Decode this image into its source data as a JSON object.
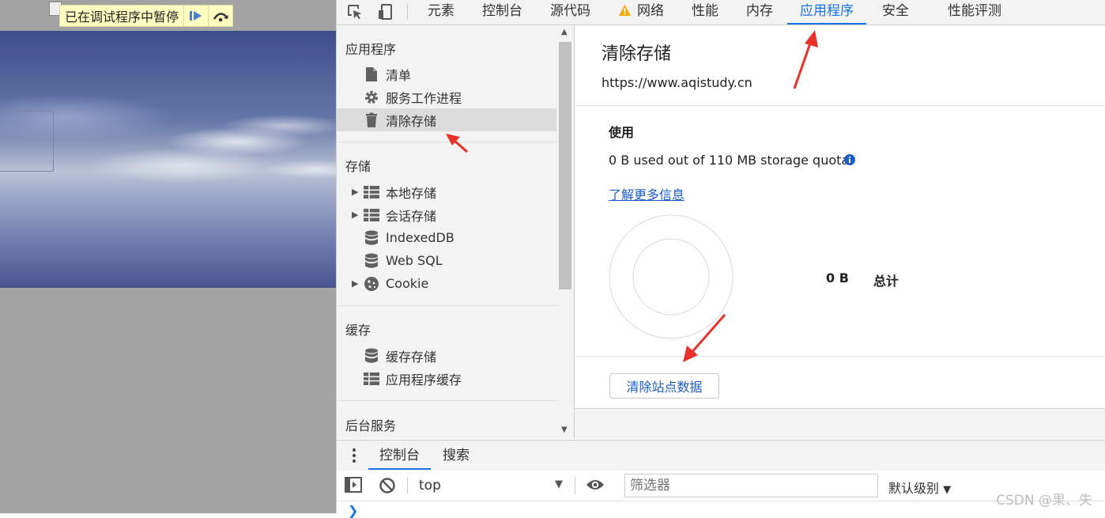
{
  "debug_banner": {
    "text": "已在调试程序中暂停",
    "resume_icon": "resume-icon",
    "step_over_icon": "step-over-icon"
  },
  "devtools": {
    "tabs": [
      "元素",
      "控制台",
      "源代码",
      "网络",
      "性能",
      "内存",
      "应用程序",
      "安全",
      "性能评测"
    ],
    "active_tab": "应用程序",
    "network_warning_icon": "warning-icon"
  },
  "sidebar": {
    "section_app": {
      "title": "应用程序",
      "items": [
        {
          "label": "清单",
          "icon": "file-icon"
        },
        {
          "label": "服务工作进程",
          "icon": "gear-icon"
        },
        {
          "label": "清除存储",
          "icon": "trash-icon",
          "selected": true
        }
      ]
    },
    "section_storage": {
      "title": "存储",
      "items": [
        {
          "label": "本地存储",
          "icon": "grid-icon",
          "expandable": true
        },
        {
          "label": "会话存储",
          "icon": "grid-icon",
          "expandable": true
        },
        {
          "label": "IndexedDB",
          "icon": "database-icon"
        },
        {
          "label": "Web SQL",
          "icon": "database-icon"
        },
        {
          "label": "Cookie",
          "icon": "cookie-icon",
          "expandable": true
        }
      ]
    },
    "section_cache": {
      "title": "缓存",
      "items": [
        {
          "label": "缓存存储",
          "icon": "database-icon"
        },
        {
          "label": "应用程序缓存",
          "icon": "grid-icon"
        }
      ]
    },
    "section_background": {
      "title": "后台服务"
    }
  },
  "main": {
    "title": "清除存储",
    "origin": "https://www.aqistudy.cn",
    "usage_heading": "使用",
    "usage_text": "0 B used out of 110 MB storage quota.",
    "learn_more": "了解更多信息",
    "legend_value": "0 B",
    "legend_label": "总计",
    "clear_button": "清除站点数据"
  },
  "drawer": {
    "tabs": [
      "控制台",
      "搜索"
    ],
    "active_tab": "控制台",
    "context": "top",
    "filter_placeholder": "筛选器",
    "levels": "默认级别"
  },
  "watermark": "CSDN @果、失",
  "colors": {
    "accent": "#1a73e8",
    "annotation_arrow": "#e8322b",
    "warning": "#f2a900"
  }
}
